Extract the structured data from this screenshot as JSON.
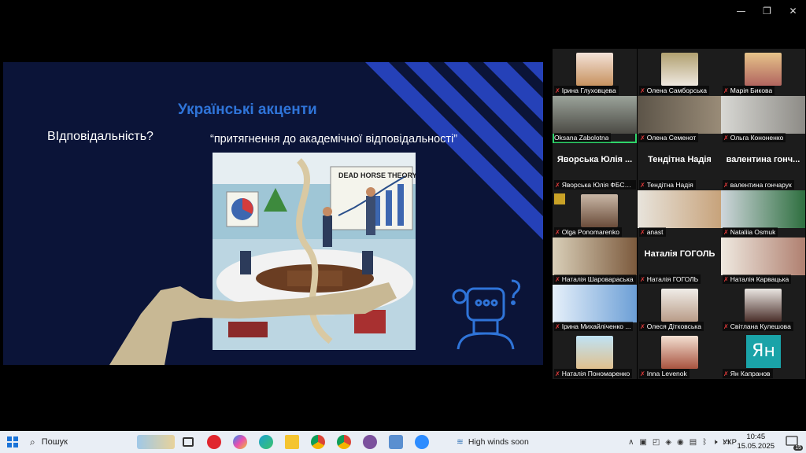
{
  "window": {
    "minimize_icon": "minimize-icon",
    "restore_icon": "restore-icon",
    "close_icon": "close-icon"
  },
  "slide": {
    "title": "Українські акценти",
    "question": "ВIдповідальність?",
    "quote": "“притягнення до академічної відповідальності”",
    "poster_text": "DEAD HORSE THEORY"
  },
  "participants": [
    {
      "name": "Ірина Глуховцева",
      "muted": true
    },
    {
      "name": "Олена Самборська",
      "muted": true
    },
    {
      "name": "Марія Бикова",
      "muted": true
    },
    {
      "name": "Oksana Zabolotna",
      "muted": false,
      "active": true
    },
    {
      "name": "Олена Семенот",
      "muted": true
    },
    {
      "name": "Ольга Кононенко",
      "muted": true
    },
    {
      "name": "Яворська Юлія ФБСм-...",
      "display": "Яворська Юлія ...",
      "muted": true
    },
    {
      "name": "Тендітна Надія",
      "display": "Тендітна Надія",
      "muted": true
    },
    {
      "name": "валентина гончарук",
      "display": "валентина гонч...",
      "muted": true
    },
    {
      "name": "Olga Ponomarenko",
      "muted": true
    },
    {
      "name": "anast",
      "muted": true
    },
    {
      "name": "Nataliia Osmuk",
      "muted": true
    },
    {
      "name": "Наталія Шаровараська",
      "muted": true
    },
    {
      "name": "Наталія ГОГОЛЬ",
      "display": "Наталія ГОГОЛЬ",
      "muted": true
    },
    {
      "name": "Наталія Карвацька",
      "muted": true
    },
    {
      "name": "Ірина Михайліченко ...",
      "muted": true
    },
    {
      "name": "Олеся Дітковська",
      "muted": true
    },
    {
      "name": "Світлана Кулешова",
      "muted": true
    },
    {
      "name": "Наталія Пономаренко",
      "muted": true
    },
    {
      "name": "Inna Levenok",
      "muted": true
    },
    {
      "name": "Ян Капранов",
      "avatar_text": "Ян",
      "muted": true
    }
  ],
  "taskbar": {
    "search_label": "Пошук",
    "weather_text": "High winds soon",
    "language": "УКР",
    "time": "10:45",
    "date": "15.05.2025",
    "notification_count": "15"
  },
  "colors": {
    "slide_bg": "#0b1438",
    "title": "#2f74d8",
    "stripe": "#2541b8",
    "active_border": "#2fd66b",
    "mic_muted": "#e43b3b",
    "taskbar": "#e9eef5"
  }
}
